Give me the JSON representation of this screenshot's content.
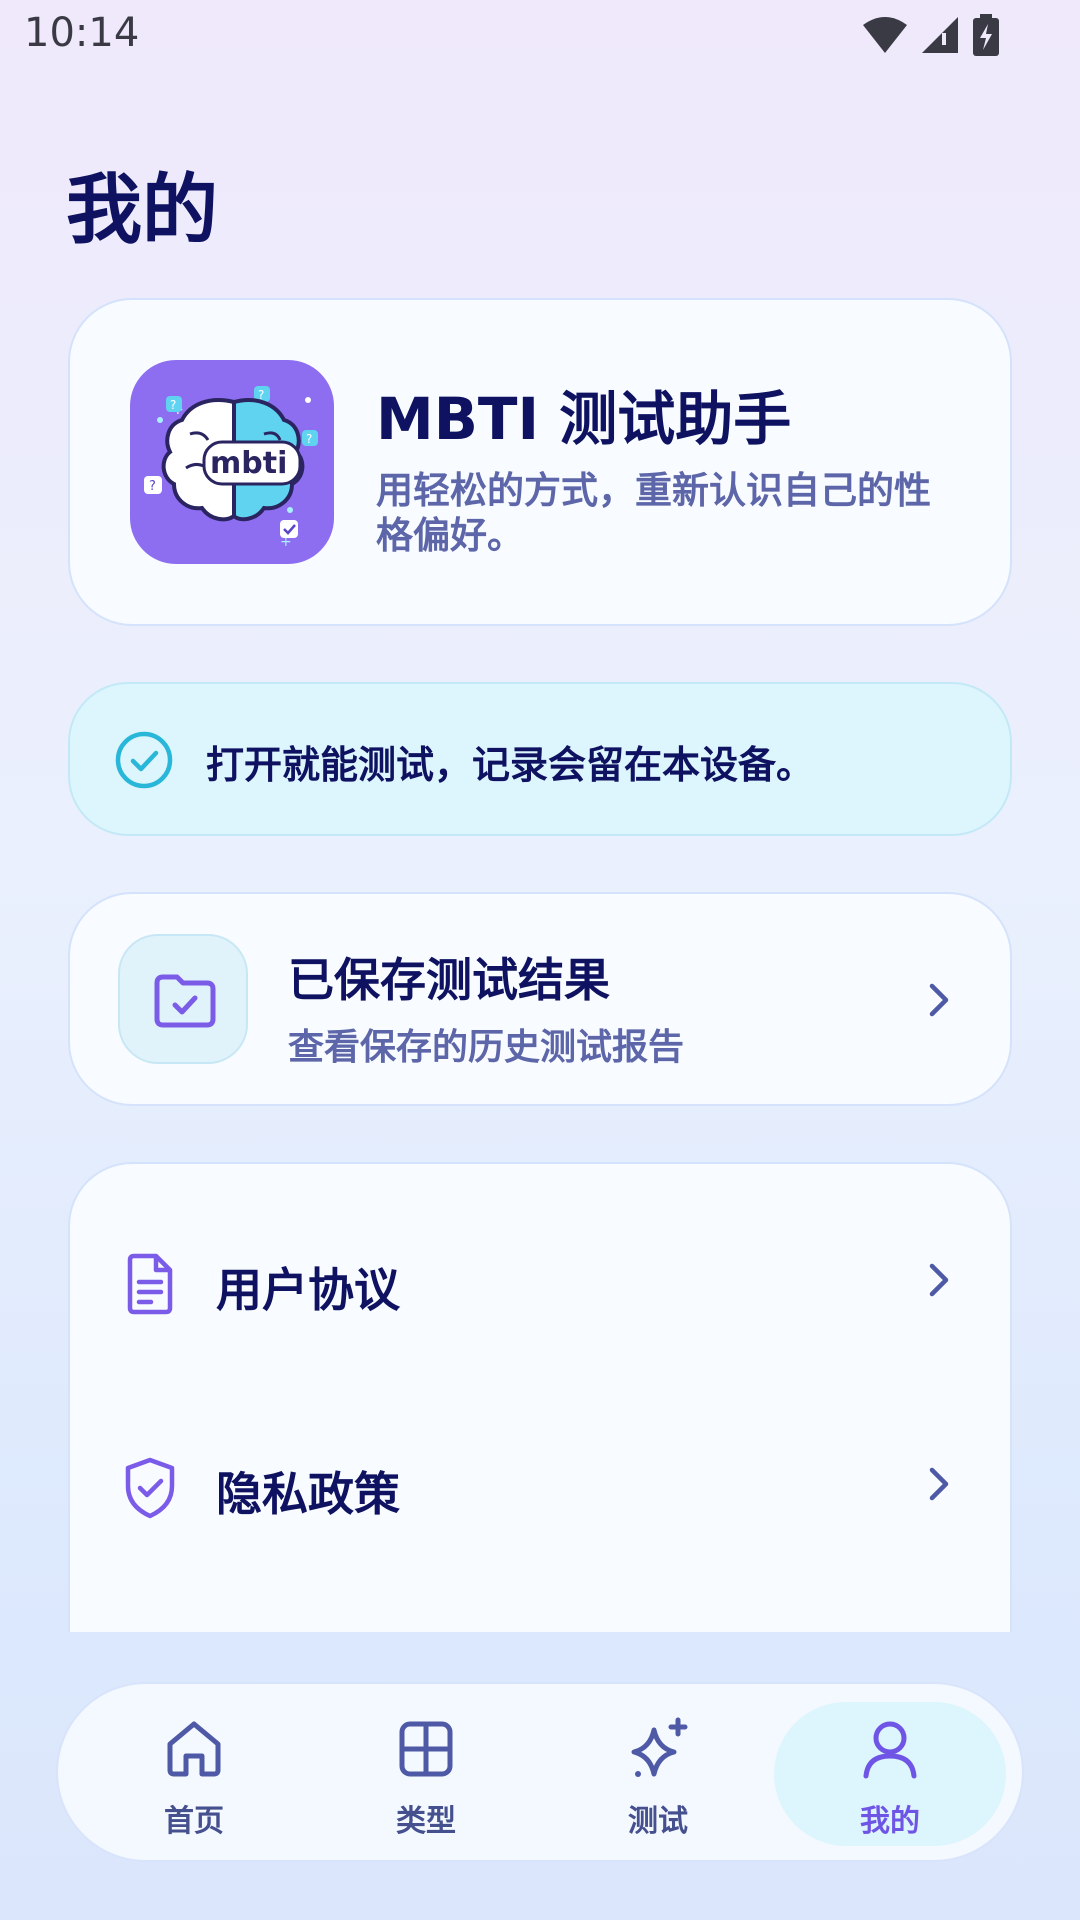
{
  "status_bar": {
    "time": "10:14"
  },
  "page": {
    "title": "我的"
  },
  "profile": {
    "app_name": "MBTI 测试助手",
    "description": "用轻松的方式，重新认识自己的性格偏好。",
    "logo_text": "mbti"
  },
  "notice": {
    "text": "打开就能测试，记录会留在本设备。"
  },
  "saved": {
    "title": "已保存测试结果",
    "subtitle": "查看保存的历史测试报告"
  },
  "menu": {
    "items": [
      {
        "label": "用户协议",
        "icon": "document-icon"
      },
      {
        "label": "隐私政策",
        "icon": "shield-check-icon"
      }
    ]
  },
  "nav": {
    "items": [
      {
        "label": "首页",
        "icon": "home-icon"
      },
      {
        "label": "类型",
        "icon": "grid-icon"
      },
      {
        "label": "测试",
        "icon": "sparkle-icon"
      },
      {
        "label": "我的",
        "icon": "user-icon",
        "active": true
      }
    ]
  },
  "colors": {
    "title": "#0e1260",
    "accent": "#6f55e6",
    "teal": "#29b7d9",
    "subtext": "#5c66a8"
  }
}
